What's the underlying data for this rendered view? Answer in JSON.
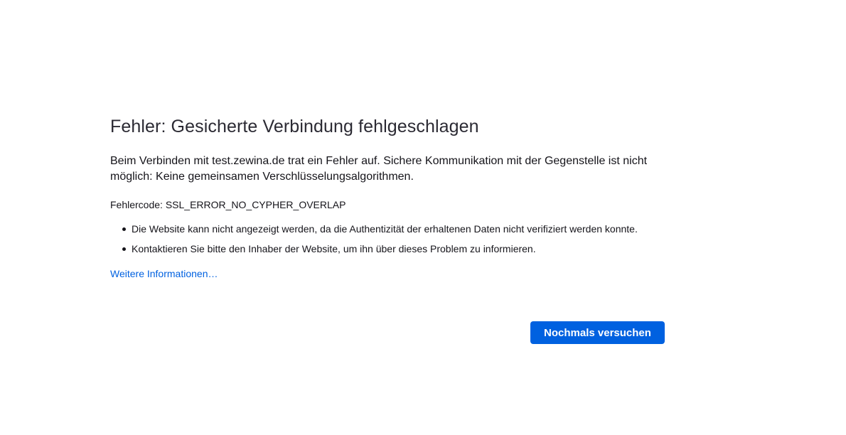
{
  "error_page": {
    "title": "Fehler: Gesicherte Verbindung fehlgeschlagen",
    "description": "Beim Verbinden mit test.zewina.de trat ein Fehler auf. Sichere Kommunikation mit der Gegenstelle ist nicht möglich: Keine gemeinsamen Verschlüsselungsalgorithmen.",
    "error_code": "Fehlercode: SSL_ERROR_NO_CYPHER_OVERLAP",
    "bullets": [
      "Die Website kann nicht angezeigt werden, da die Authentizität der erhaltenen Daten nicht verifiziert werden konnte.",
      "Kontaktieren Sie bitte den Inhaber der Website, um ihn über dieses Problem zu informieren."
    ],
    "learn_more_label": "Weitere Informationen…",
    "try_again_label": "Nochmals versuchen"
  },
  "colors": {
    "accent": "#0061e0",
    "text": "#15141a",
    "background": "#ffffff"
  }
}
